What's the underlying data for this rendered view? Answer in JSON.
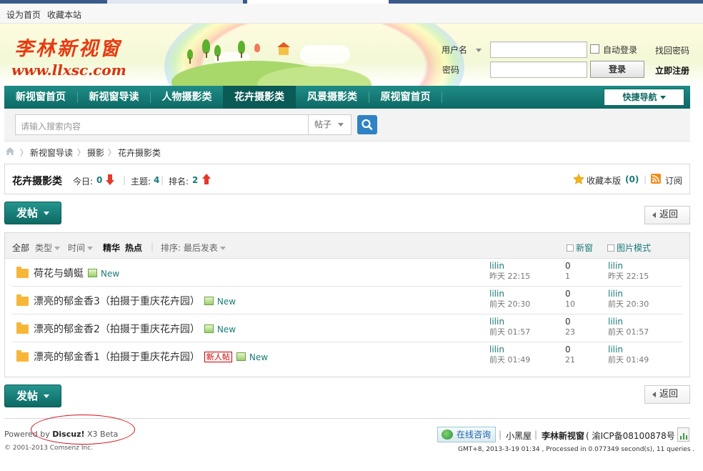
{
  "topbar": {
    "set_home": "设为首页",
    "bookmark": "收藏本站"
  },
  "logo": {
    "cn": "李林新视窗",
    "en": "www.llxsc.com"
  },
  "login": {
    "username_label": "用户名",
    "password_label": "密码",
    "auto_login": "自动登录",
    "forgot": "找回密码",
    "login_button": "登录",
    "register": "立即注册"
  },
  "nav": {
    "items": [
      "新视窗首页",
      "新视窗导读",
      "人物摄影类",
      "花卉摄影类",
      "风景摄影类",
      "原视窗首页"
    ],
    "active_index": 3,
    "quick_nav": "快捷导航"
  },
  "search": {
    "placeholder": "请输入搜索内容",
    "type": "帖子"
  },
  "breadcrumb": {
    "items": [
      "新视窗导读",
      "摄影",
      "花卉摄影类"
    ]
  },
  "forum": {
    "name": "花卉摄影类",
    "today_label": "今日:",
    "today": "0",
    "topics_label": "主题:",
    "topics": "4",
    "rank_label": "排名:",
    "rank": "2",
    "favorite_label": "收藏本版",
    "favorite_count": "(0)",
    "subscribe": "订阅"
  },
  "actions": {
    "post": "发帖",
    "back": "返回"
  },
  "list_header": {
    "all": "全部",
    "type": "类型",
    "time": "时间",
    "digest": "精华",
    "hot": "热点",
    "sort": "排序: 最后发表",
    "new_window": "新窗",
    "image_mode": "图片模式"
  },
  "threads": [
    {
      "title": "荷花与蜻蜓",
      "newbie": "",
      "new": "New",
      "author": "lilin",
      "post_time": "昨天 22:15",
      "replies": "0",
      "views": "1",
      "last_author": "lilin",
      "last_time": "昨天 22:15"
    },
    {
      "title": "漂亮的郁金香3（拍摄于重庆花卉园）",
      "newbie": "",
      "new": "New",
      "author": "lilin",
      "post_time": "前天 20:30",
      "replies": "0",
      "views": "10",
      "last_author": "lilin",
      "last_time": "前天 20:30"
    },
    {
      "title": "漂亮的郁金香2（拍摄于重庆花卉园）",
      "newbie": "",
      "new": "New",
      "author": "lilin",
      "post_time": "前天 01:57",
      "replies": "0",
      "views": "23",
      "last_author": "lilin",
      "last_time": "前天 01:57"
    },
    {
      "title": "漂亮的郁金香1（拍摄于重庆花卉园）",
      "newbie": "新人帖",
      "new": "New",
      "author": "lilin",
      "post_time": "前天 01:49",
      "replies": "0",
      "views": "21",
      "last_author": "lilin",
      "last_time": "前天 01:49"
    }
  ],
  "footer": {
    "powered_prefix": "Powered by ",
    "powered_brand": "Discuz!",
    "powered_version": " X3 Beta",
    "copyright": "© 2001-2013 Comsenz Inc.",
    "consult": "在线咨询",
    "sep": "|",
    "xiaoheiwu": "小黑屋",
    "site_name": "李林新视窗",
    "icp": "( 渝ICP备08100878号 )",
    "stats": "GMT+8, 2013-3-19 01:34 , Processed in 0.077349 second(s), 11 queries ."
  },
  "colors": {
    "nav": "#0d6964",
    "accent": "#1b7a7a",
    "logo": "#e63b12",
    "search_button": "#2f83c5"
  }
}
